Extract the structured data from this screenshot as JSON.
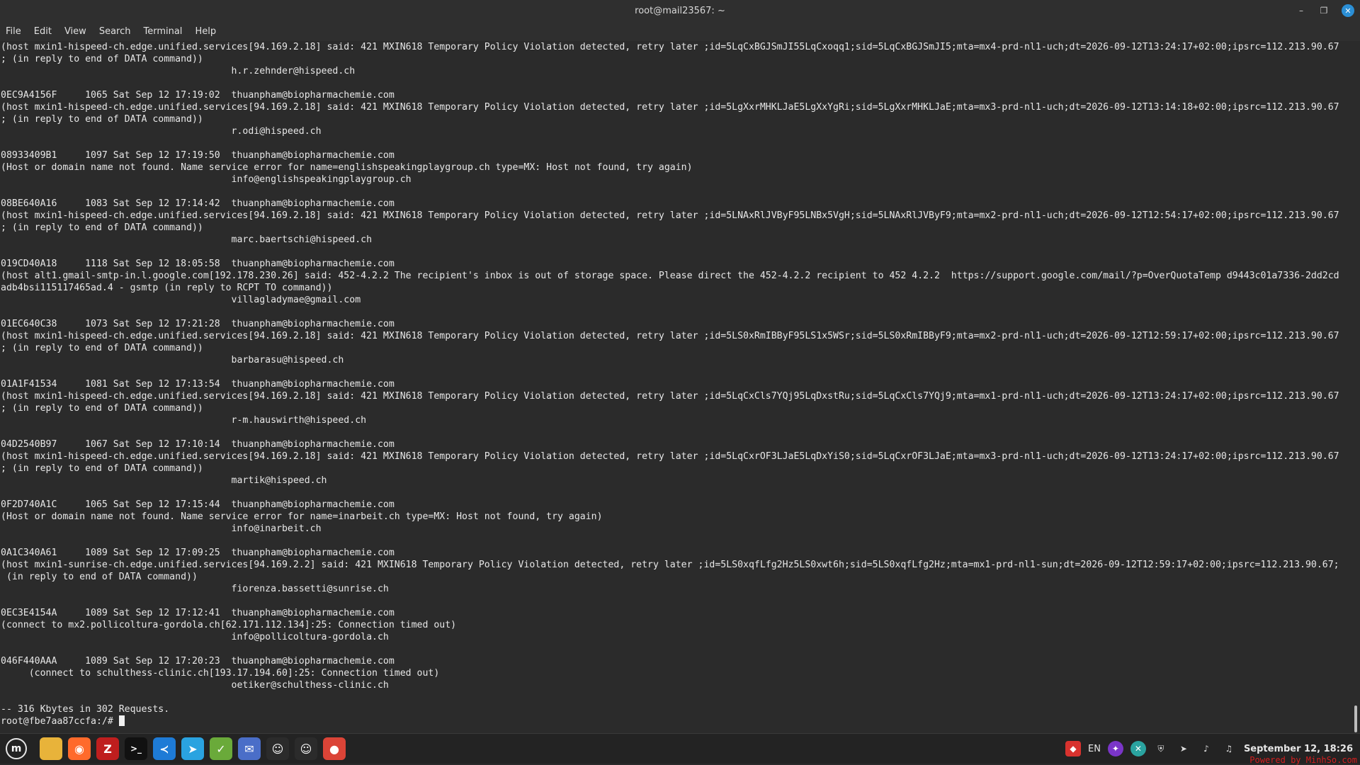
{
  "window": {
    "title": "root@mail23567: ~"
  },
  "menu": [
    "File",
    "Edit",
    "View",
    "Search",
    "Terminal",
    "Help"
  ],
  "terminal_lines": [
    "(host mxin1-hispeed-ch.edge.unified.services[94.169.2.18] said: 421 MXIN618 Temporary Policy Violation detected, retry later ;id=5LqCxBGJSmJI55LqCxoqq1;sid=5LqCxBGJSmJI5;mta=mx4-prd-nl1-uch;dt=2026-09-12T13:24:17+02:00;ipsrc=112.213.90.67",
    "; (in reply to end of DATA command))",
    "                                         h.r.zehnder@hispeed.ch",
    "",
    "0EC9A4156F     1065 Sat Sep 12 17:19:02  thuanpham@biopharmachemie.com",
    "(host mxin1-hispeed-ch.edge.unified.services[94.169.2.18] said: 421 MXIN618 Temporary Policy Violation detected, retry later ;id=5LgXxrMHKLJaE5LgXxYgRi;sid=5LgXxrMHKLJaE;mta=mx3-prd-nl1-uch;dt=2026-09-12T13:14:18+02:00;ipsrc=112.213.90.67",
    "; (in reply to end of DATA command))",
    "                                         r.odi@hispeed.ch",
    "",
    "08933409B1     1097 Sat Sep 12 17:19:50  thuanpham@biopharmachemie.com",
    "(Host or domain name not found. Name service error for name=englishspeakingplaygroup.ch type=MX: Host not found, try again)",
    "                                         info@englishspeakingplaygroup.ch",
    "",
    "08BE640A16     1083 Sat Sep 12 17:14:42  thuanpham@biopharmachemie.com",
    "(host mxin1-hispeed-ch.edge.unified.services[94.169.2.18] said: 421 MXIN618 Temporary Policy Violation detected, retry later ;id=5LNAxRlJVByF95LNBx5VgH;sid=5LNAxRlJVByF9;mta=mx2-prd-nl1-uch;dt=2026-09-12T12:54:17+02:00;ipsrc=112.213.90.67",
    "; (in reply to end of DATA command))",
    "                                         marc.baertschi@hispeed.ch",
    "",
    "019CD40A18     1118 Sat Sep 12 18:05:58  thuanpham@biopharmachemie.com",
    "(host alt1.gmail-smtp-in.l.google.com[192.178.230.26] said: 452-4.2.2 The recipient's inbox is out of storage space. Please direct the 452-4.2.2 recipient to 452 4.2.2  https://support.google.com/mail/?p=OverQuotaTemp d9443c01a7336-2dd2cd",
    "adb4bsi115117465ad.4 - gsmtp (in reply to RCPT TO command))",
    "                                         villagladymae@gmail.com",
    "",
    "01EC640C38     1073 Sat Sep 12 17:21:28  thuanpham@biopharmachemie.com",
    "(host mxin1-hispeed-ch.edge.unified.services[94.169.2.18] said: 421 MXIN618 Temporary Policy Violation detected, retry later ;id=5LS0xRmIBByF95LS1x5WSr;sid=5LS0xRmIBByF9;mta=mx2-prd-nl1-uch;dt=2026-09-12T12:59:17+02:00;ipsrc=112.213.90.67",
    "; (in reply to end of DATA command))",
    "                                         barbarasu@hispeed.ch",
    "",
    "01A1F41534     1081 Sat Sep 12 17:13:54  thuanpham@biopharmachemie.com",
    "(host mxin1-hispeed-ch.edge.unified.services[94.169.2.18] said: 421 MXIN618 Temporary Policy Violation detected, retry later ;id=5LqCxCls7YQj95LqDxstRu;sid=5LqCxCls7YQj9;mta=mx1-prd-nl1-uch;dt=2026-09-12T13:24:17+02:00;ipsrc=112.213.90.67",
    "; (in reply to end of DATA command))",
    "                                         r-m.hauswirth@hispeed.ch",
    "",
    "04D2540B97     1067 Sat Sep 12 17:10:14  thuanpham@biopharmachemie.com",
    "(host mxin1-hispeed-ch.edge.unified.services[94.169.2.18] said: 421 MXIN618 Temporary Policy Violation detected, retry later ;id=5LqCxrOF3LJaE5LqDxYiS0;sid=5LqCxrOF3LJaE;mta=mx3-prd-nl1-uch;dt=2026-09-12T13:24:17+02:00;ipsrc=112.213.90.67",
    "; (in reply to end of DATA command))",
    "                                         martik@hispeed.ch",
    "",
    "0F2D740A1C     1065 Sat Sep 12 17:15:44  thuanpham@biopharmachemie.com",
    "(Host or domain name not found. Name service error for name=inarbeit.ch type=MX: Host not found, try again)",
    "                                         info@inarbeit.ch",
    "",
    "0A1C340A61     1089 Sat Sep 12 17:09:25  thuanpham@biopharmachemie.com",
    "(host mxin1-sunrise-ch.edge.unified.services[94.169.2.2] said: 421 MXIN618 Temporary Policy Violation detected, retry later ;id=5LS0xqfLfg2Hz5LS0xwt6h;sid=5LS0xqfLfg2Hz;mta=mx1-prd-nl1-sun;dt=2026-09-12T12:59:17+02:00;ipsrc=112.213.90.67;",
    " (in reply to end of DATA command))",
    "                                         fiorenza.bassetti@sunrise.ch",
    "",
    "0EC3E4154A     1089 Sat Sep 12 17:12:41  thuanpham@biopharmachemie.com",
    "(connect to mx2.pollicoltura-gordola.ch[62.171.112.134]:25: Connection timed out)",
    "                                         info@pollicoltura-gordola.ch",
    "",
    "046F440AAA     1089 Sat Sep 12 17:20:23  thuanpham@biopharmachemie.com",
    "     (connect to schulthess-clinic.ch[193.17.194.60]:25: Connection timed out)",
    "                                         oetiker@schulthess-clinic.ch",
    "",
    "-- 316 Kbytes in 302 Requests."
  ],
  "prompt": "root@fbe7aa87ccfa:/# ",
  "taskbar": {
    "apps": [
      {
        "name": "mint-menu-icon",
        "glyph": "m",
        "color": "#2f2f2f"
      },
      {
        "name": "files-icon",
        "glyph": "",
        "color": "#e8b33a"
      },
      {
        "name": "firefox-icon",
        "glyph": "◉",
        "color": "#ff6a2b"
      },
      {
        "name": "filezilla-icon",
        "glyph": "Z",
        "color": "#bf1e1e"
      },
      {
        "name": "terminal-icon",
        "glyph": ">_",
        "color": "#111111"
      },
      {
        "name": "vscode-icon",
        "glyph": "≺",
        "color": "#1e7bd6"
      },
      {
        "name": "telegram-icon",
        "glyph": "➤",
        "color": "#2aa3e0"
      },
      {
        "name": "update-manager-icon",
        "glyph": "✓",
        "color": "#6aaa3a"
      },
      {
        "name": "mail-icon",
        "glyph": "✉",
        "color": "#4a6ec8"
      },
      {
        "name": "app-icon-1",
        "glyph": "☺",
        "color": "#2b2b2b"
      },
      {
        "name": "app-icon-2",
        "glyph": "☺",
        "color": "#2b2b2b"
      },
      {
        "name": "chrome-icon",
        "glyph": "●",
        "color": "#db4437"
      }
    ],
    "tray": {
      "language": "EN",
      "datetime": "September 12, 18:26"
    }
  },
  "watermark": "Powered by MinhSo.com"
}
